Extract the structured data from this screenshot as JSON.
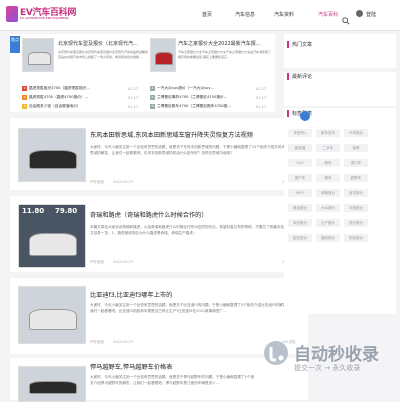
{
  "header": {
    "logo_text": "EV汽车百科网",
    "logo_sub": "EV AUTOMOTIVE ENCYCLOPEDIA",
    "nav": [
      "首页",
      "汽车信息",
      "汽车资料",
      "汽车百科"
    ],
    "active_nav_index": 3,
    "login": "登陆",
    "accent_color": "#c4347f"
  },
  "focus": {
    "label": "焦点",
    "items": [
      {
        "title": "北京现代车型及报价（北京现代汽…",
        "text": "北京现代车型及报价北京现代车型及报价北京现代汽车的品牌战略简直是在中国汽车市场上掀起了一场大风暴，希望我这篇文章能..."
      },
      {
        "title": "汽车之家报价大全2022最新汽车报…",
        "text": "汽车之家报价大全汽车之家报价大全汽车之家报价大全是汽车消费者了解行情的重要途径,事实上要要知道它..."
      }
    ],
    "list": [
      {
        "n": "1",
        "color": "#e2493f",
        "title": "路虎揽胜极光4700（路虎揽胜极光...",
        "date": "01-17"
      },
      {
        "n": "2",
        "color": "#f08a2a",
        "title": "路虎揽胜4700（路虎4700报价）...",
        "date": "01-17"
      },
      {
        "n": "3",
        "color": "#f0b72a",
        "title": "自由舰多少钱（自由舰落地价）",
        "date": "01-17"
      },
      {
        "n": "4",
        "color": "#9aa",
        "title": "一汽大众suv报价（一汽大众suv…",
        "date": "01-17"
      },
      {
        "n": "5",
        "color": "#9aa",
        "title": "兰博基尼毒药4700（兰博基尼4700报价…",
        "date": "01-17"
      },
      {
        "n": "6",
        "color": "#9aa",
        "title": "兰博基尼跑车4700（兰博基尼跑车4700报…",
        "date": "01-17"
      }
    ]
  },
  "articles": [
    {
      "title": "东风本田新思域,东风本田新思域车窗升降失灵恢复方法视频",
      "excerpt": "大家好，今天小编关注到一个比较有意思的话题，就是关于东风本田新思域的问题，于是小编就整理了15个相关介绍东风本田新思域的解答，让我们一起看看吧。东风本田新思域的机油什么型号好？怎样在思域中使用？",
      "cat": "汽车信息",
      "date": "2024-09-27",
      "views": "137浏览"
    },
    {
      "title": "奇瑞和路虎（奇瑞和路虎什么时候合作的）",
      "excerpt": "本篇文章给大家谈谈奇瑞和路虎，以及奇瑞和路虎什么时候合作的对应的知识点，希望对各位有所帮助，不要忘了收藏本站喔。本文目录一览：1、路虎被收购后为什么路虎是奇瑞，奇瑞生产路虎...",
      "cat": "汽车信息",
      "date": "2024-09-27",
      "views": "151浏览"
    },
    {
      "title": "比亚迪f3,比亚迪f3哪年上市的",
      "excerpt": "大家好，今天小编关注到一个比较有意思的话题，就是关于比亚迪f3的问题，于是小编就整理了5个相关介绍比亚迪f3的解答，让我们一起看看吧。比亚迪f3前脸和车尾是否已停止生产?比亚迪f3在2021款事故里厂...",
      "cat": "汽车信息",
      "date": "2024-09-27",
      "views": "191浏览"
    },
    {
      "title": "悍马越野车,悍马越野车价格表",
      "excerpt": "大家好，今天小编关注到一个比较有意思的话题，就是关于悍马越野车的问题，于是小编就整理了5个相关介绍悍马越野车的解答，让我们一起看看吧。悍马越野车是几座的车辆是多少...",
      "cat": "汽车信息",
      "date": "2024-09-27",
      "views": ""
    }
  ],
  "article_overlays": [
    "11.80",
    "79.80"
  ],
  "sidebar": {
    "hot_title": "热门文章",
    "recent_title": "最新评论",
    "tags_title": "标签列表",
    "tags": [
      "车型号1",
      "新车发布",
      "汽车报价",
      "新能源",
      "二手车",
      "保养",
      "SUV",
      "轿车",
      "进口车",
      "国产车",
      "跑车",
      "越野车",
      "MPV",
      "奔驰报价",
      "宝马报价",
      "奥迪报价",
      "大众报价",
      "丰田报价",
      "本田报价",
      "日产报价",
      "现代报价",
      "起亚报价",
      "福特报价",
      "别克报价"
    ]
  },
  "watermark": {
    "text": "自动秒收录",
    "sub": "提交一次 → 永久收录"
  }
}
